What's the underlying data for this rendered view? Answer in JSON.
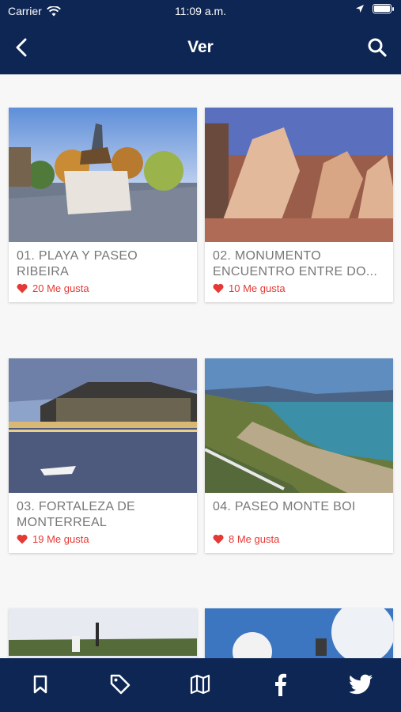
{
  "status": {
    "carrier": "Carrier",
    "time": "11:09 a.m."
  },
  "nav": {
    "title": "Ver"
  },
  "cards": [
    {
      "title_line1": "01. PLAYA Y PASEO",
      "title_line2": "RIBEIRA",
      "likes": "20 Me gusta"
    },
    {
      "title_line1": "02. MONUMENTO",
      "title_line2": "ENCUENTRO ENTRE DO...",
      "likes": "10 Me gusta"
    },
    {
      "title_line1": "03. FORTALEZA DE",
      "title_line2": "MONTERREAL",
      "likes": "19 Me gusta"
    },
    {
      "title_line1": "04. PASEO MONTE BOI",
      "title_line2": "",
      "likes": "8 Me gusta"
    }
  ],
  "tabs": [
    "bookmark-icon",
    "tag-icon",
    "map-icon",
    "facebook-icon",
    "twitter-icon"
  ],
  "colors": {
    "brand": "#0e2653",
    "like": "#e53935",
    "background": "#f7f7f7"
  }
}
